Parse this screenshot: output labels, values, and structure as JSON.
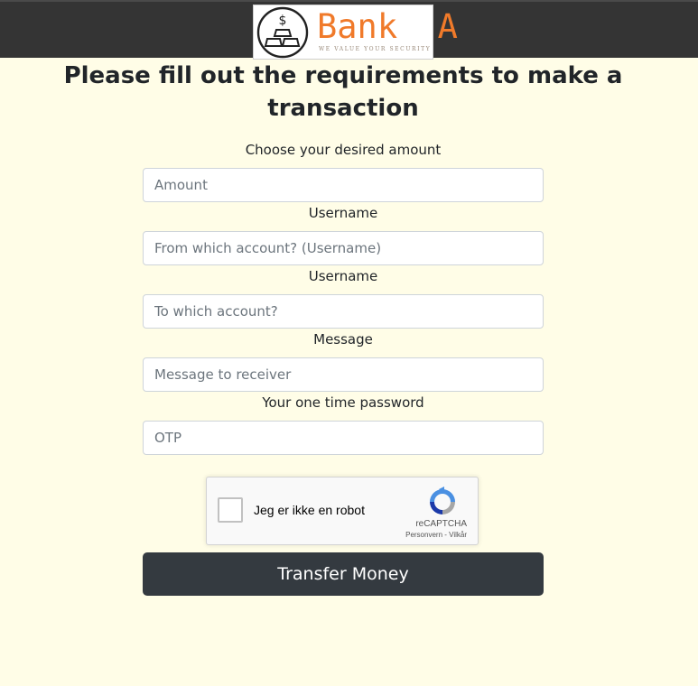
{
  "header": {
    "brand": "Bank  A",
    "tagline": "We value your security",
    "logo_icon": "gold-bars-dollar-icon",
    "bar_color": "#343434"
  },
  "page": {
    "title": "Please fill out the requirements to make a transaction",
    "background": "#fffde7"
  },
  "form": {
    "fields": [
      {
        "label": "Choose your desired amount",
        "placeholder": "Amount",
        "value": ""
      },
      {
        "label": "Username",
        "placeholder": "From which account? (Username)",
        "value": ""
      },
      {
        "label": "Username",
        "placeholder": "To which account?",
        "value": ""
      },
      {
        "label": "Message",
        "placeholder": "Message to receiver",
        "value": ""
      },
      {
        "label": "Your one time password",
        "placeholder": "OTP",
        "value": ""
      }
    ]
  },
  "captcha": {
    "checkbox_label": "Jeg er ikke en robot",
    "brand": "reCAPTCHA",
    "privacy": "Personvern",
    "separator": " - ",
    "terms": "Vilkår",
    "checked": false,
    "icon": "recaptcha-icon"
  },
  "submit": {
    "label": "Transfer Money",
    "color": "#343a40"
  }
}
